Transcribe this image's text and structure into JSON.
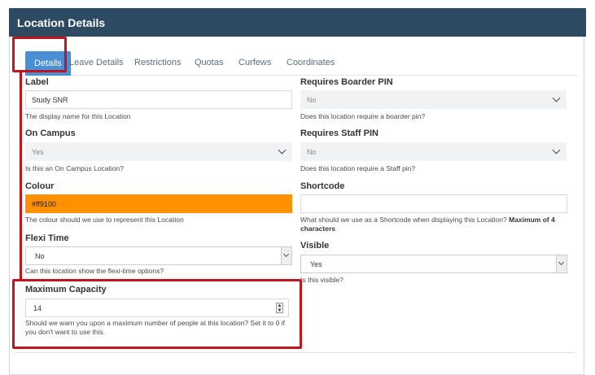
{
  "header": {
    "title": "Location Details"
  },
  "tabs": [
    {
      "label": "Details",
      "active": true
    },
    {
      "label": "Leave Details"
    },
    {
      "label": "Restrictions"
    },
    {
      "label": "Quotas"
    },
    {
      "label": "Curfews"
    },
    {
      "label": "Coordinates"
    }
  ],
  "form": {
    "label": {
      "title": "Label",
      "value": "Study SNR",
      "help": "The display name for this Location"
    },
    "on_campus": {
      "title": "On Campus",
      "value": "Yes",
      "help": "Is this an On Campus Location?"
    },
    "colour": {
      "title": "Colour",
      "value": "#ff9100",
      "help": "The colour should we use to represent this Location",
      "swatch": "#ff9100"
    },
    "flexi_time": {
      "title": "Flexi Time",
      "value": "No",
      "help": "Can this location show the flexi-time options?"
    },
    "max_capacity": {
      "title": "Maximum Capacity",
      "value": "14",
      "help": "Should we warn you upon a maximum number of people at this location? Set it to 0 if you don't want to use this."
    },
    "boarder_pin": {
      "title": "Requires Boarder PIN",
      "value": "No",
      "help": "Does this location require a boarder pin?"
    },
    "staff_pin": {
      "title": "Requires Staff PIN",
      "value": "No",
      "help": "Does this location require a Staff pin?"
    },
    "shortcode": {
      "title": "Shortcode",
      "value": "",
      "help": "What should we use as a Shortcode when displaying this Location?",
      "help_bold": "Maximum of 4 characters"
    },
    "visible": {
      "title": "Visible",
      "value": "Yes",
      "help": "Is this visible?"
    }
  },
  "colors": {
    "header_bg": "#2d4a63",
    "active_tab": "#4a8fd6",
    "highlight": "#c0151c"
  }
}
